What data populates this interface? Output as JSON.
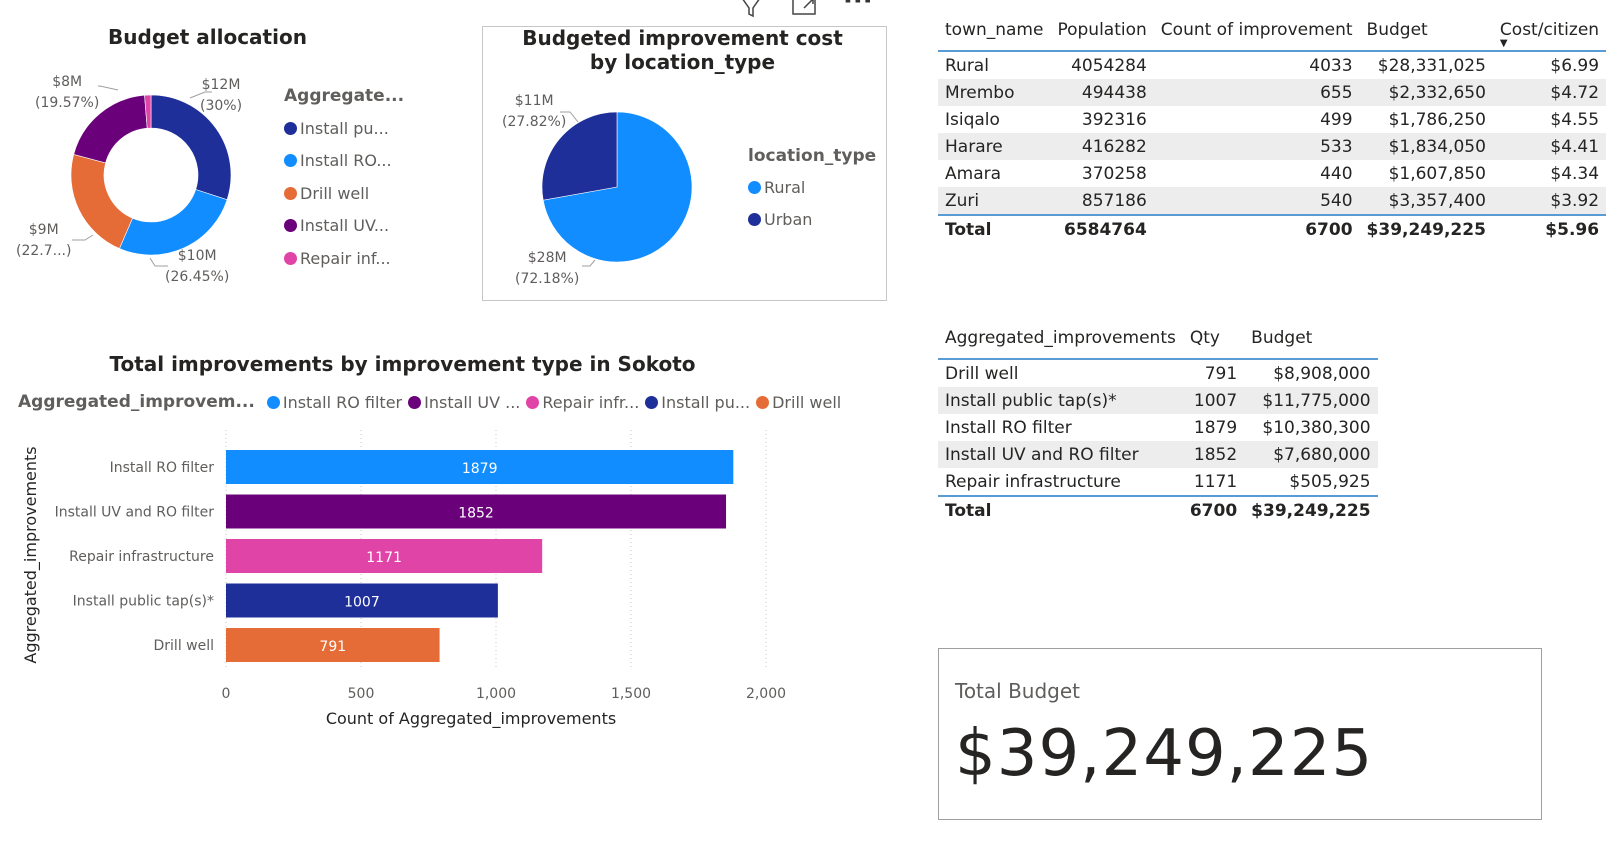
{
  "colors": {
    "dark_blue": "#1f2f99",
    "light_blue": "#118dff",
    "orange": "#e66c37",
    "purple": "#6b007b",
    "pink": "#e044a7",
    "grid": "#c8c6c4",
    "table_accent": "#5b9bd5"
  },
  "toolbar": {
    "filter_icon": "filter-icon",
    "focus_icon": "focus-mode-icon",
    "more_icon": "more-options-icon",
    "more_label": "···"
  },
  "donut": {
    "title": "Budget allocation",
    "legend_title": "Aggregate...",
    "legend": [
      "Install pu...",
      "Install RO...",
      "Drill well",
      "Install UV...",
      "Repair inf..."
    ],
    "labels": [
      {
        "value": "$12M",
        "pct": "(30%)"
      },
      {
        "value": "$10M",
        "pct": "(26.45%)"
      },
      {
        "value": "$9M",
        "pct": "(22.7...)"
      },
      {
        "value": "$8M",
        "pct": "(19.57%)"
      }
    ]
  },
  "pie": {
    "title": "Budgeted improvement cost by location_type",
    "legend_title": "location_type",
    "legend": [
      "Rural",
      "Urban"
    ],
    "labels": [
      {
        "value": "$11M",
        "pct": "(27.82%)"
      },
      {
        "value": "$28M",
        "pct": "(72.18%)"
      }
    ]
  },
  "town_table": {
    "headers": [
      "town_name",
      "Population",
      "Count of improvement",
      "Budget",
      "Cost/citizen"
    ],
    "rows": [
      [
        "Rural",
        "4054284",
        "4033",
        "$28,331,025",
        "$6.99"
      ],
      [
        "Mrembo",
        "494438",
        "655",
        "$2,332,650",
        "$4.72"
      ],
      [
        "Isiqalo",
        "392316",
        "499",
        "$1,786,250",
        "$4.55"
      ],
      [
        "Harare",
        "416282",
        "533",
        "$1,834,050",
        "$4.41"
      ],
      [
        "Amara",
        "370258",
        "440",
        "$1,607,850",
        "$4.34"
      ],
      [
        "Zuri",
        "857186",
        "540",
        "$3,357,400",
        "$3.92"
      ]
    ],
    "total": [
      "Total",
      "6584764",
      "6700",
      "$39,249,225",
      "$5.96"
    ]
  },
  "agg_table": {
    "headers": [
      "Aggregated_improvements",
      "Qty",
      "Budget"
    ],
    "rows": [
      [
        "Drill well",
        "791",
        "$8,908,000"
      ],
      [
        "Install public tap(s)*",
        "1007",
        "$11,775,000"
      ],
      [
        "Install RO filter",
        "1879",
        "$10,380,300"
      ],
      [
        "Install UV and RO filter",
        "1852",
        "$7,680,000"
      ],
      [
        "Repair infrastructure",
        "1171",
        "$505,925"
      ]
    ],
    "total": [
      "Total",
      "6700",
      "$39,249,225"
    ]
  },
  "bar": {
    "title": "Total improvements by improvement type in Sokoto",
    "legend_title": "Aggregated_improvem...",
    "legend": [
      "Install RO filter",
      "Install UV ...",
      "Repair infr...",
      "Install pu...",
      "Drill well"
    ]
  },
  "card": {
    "label": "Total Budget",
    "value": "$39,249,225"
  },
  "chart_data": [
    {
      "type": "pie",
      "title": "Budget allocation",
      "legend_title": "Aggregate...",
      "donut": true,
      "slices": [
        {
          "name": "Install pu...",
          "value": 11775000,
          "label": "$12M",
          "pct": 30
        },
        {
          "name": "Install RO...",
          "value": 10380300,
          "label": "$10M",
          "pct": 26.45
        },
        {
          "name": "Drill well",
          "value": 8908000,
          "label": "$9M",
          "pct": 22.7
        },
        {
          "name": "Install UV...",
          "value": 7680000,
          "label": "$8M",
          "pct": 19.57
        },
        {
          "name": "Repair inf...",
          "value": 505925,
          "pct": 1.29
        }
      ]
    },
    {
      "type": "pie",
      "title": "Budgeted improvement cost by location_type",
      "legend_title": "location_type",
      "slices": [
        {
          "name": "Rural",
          "value": 28331025,
          "label": "$28M",
          "pct": 72.18
        },
        {
          "name": "Urban",
          "value": 10918200,
          "label": "$11M",
          "pct": 27.82
        }
      ]
    },
    {
      "type": "bar",
      "orientation": "horizontal",
      "title": "Total improvements by improvement type in Sokoto",
      "categories": [
        "Install RO filter",
        "Install UV and RO filter",
        "Repair infrastructure",
        "Install public tap(s)*",
        "Drill well"
      ],
      "values": [
        1879,
        1852,
        1171,
        1007,
        791
      ],
      "xlabel": "Count of Aggregated_improvements",
      "ylabel": "Aggregated_improvements",
      "xlim": [
        0,
        2000
      ],
      "xticks": [
        "0",
        "500",
        "1,000",
        "1,500",
        "2,000"
      ],
      "grid": true,
      "legend_placement": "top"
    }
  ]
}
